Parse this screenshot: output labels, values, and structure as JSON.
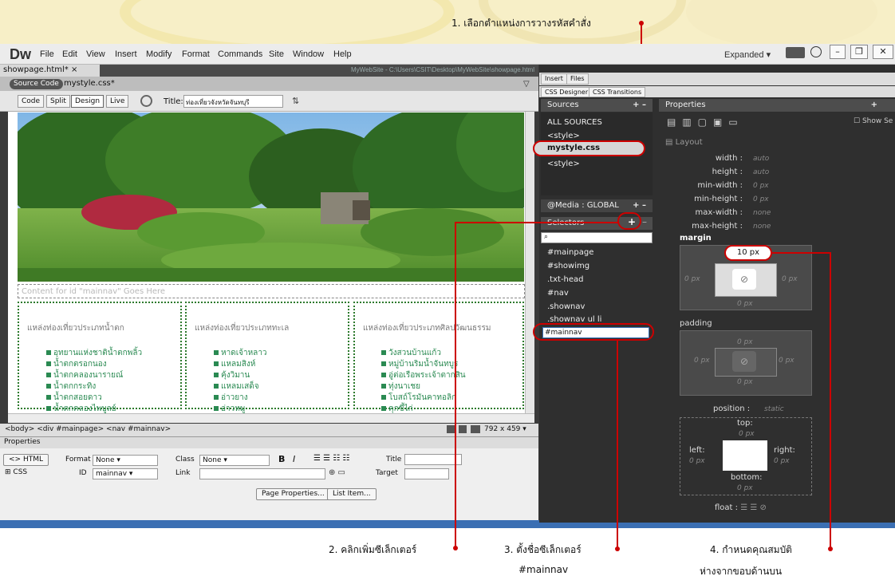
{
  "callouts": {
    "c1": "1. เลือกตำแหน่งการวางรหัสคำสั่ง",
    "c2": "2. คลิกเพิ่มซีเล็กเตอร์",
    "c3_line1": "3. ตั้งชื่อซีเล็กเตอร์",
    "c3_line2": "#mainnav",
    "c4_line1": "4. กำหนดคุณสมบัติ",
    "c4_line2": "ห่างจากขอบด้านบน"
  },
  "app": {
    "logo": "Dw",
    "menu": [
      "File",
      "Edit",
      "View",
      "Insert",
      "Modify",
      "Format",
      "Commands",
      "Site",
      "Window",
      "Help"
    ],
    "workspace": "Expanded",
    "doc_tab": "showpage.html* ×",
    "doc_path": "MyWebSite - C:\\Users\\CSIT\\Desktop\\MyWebSite\\showpage.html",
    "source_code": "Source Code",
    "related_file": "mystyle.css*",
    "views": [
      "Code",
      "Split",
      "Design",
      "Live"
    ],
    "title_label": "Title:",
    "title_value": "ท่องเที่ยวจังหวัดจันทบุรี"
  },
  "design": {
    "content_placeholder": "Content for id \"mainnav\" Goes Here",
    "columns": [
      {
        "head": "แหล่งท่องเที่ยวประเภทน้ำตก",
        "items": [
          "อุทยานแห่งชาติน้ำตกพลิ้ว",
          "น้ำตกตรอกนอง",
          "น้ำตกคลองนารายณ์",
          "น้ำตกกระทิง",
          "น้ำตกสอยดาว",
          "น้ำตกคลองไพบูลย์"
        ]
      },
      {
        "head": "แหล่งท่องเที่ยวประเภททะเล",
        "items": [
          "หาดเจ้าหลาว",
          "แหลมสิงห์",
          "คุ้งวิมาน",
          "แหลมเสด็จ",
          "อ่าวยาง",
          "อ่าวหมู"
        ]
      },
      {
        "head": "แหล่งท่องเที่ยวประเภทศิลปวัฒนธรรม",
        "items": [
          "วังสวนบ้านแก้ว",
          "หมู่บ้านริมน้ำจันทบูร",
          "อู่ต่อเรือพระเจ้าตากสิน",
          "ทุ่งนาเชย",
          "โบสถ์โรมันคาทอลิก",
          "คุกขี้ไก่"
        ]
      }
    ],
    "status_path": "<body> <div #mainpage> <nav #mainnav>",
    "window_size": "792 x 459 ▾"
  },
  "properties_panel": {
    "header": "Properties",
    "html_btn": "HTML",
    "css_btn": "CSS",
    "format_label": "Format",
    "format_value": "None",
    "class_label": "Class",
    "class_value": "None",
    "id_label": "ID",
    "id_value": "mainnav",
    "link_label": "Link",
    "title_label": "Title",
    "target_label": "Target",
    "page_properties": "Page Properties...",
    "list_item": "List Item..."
  },
  "right": {
    "insert_tabs": [
      "Insert",
      "Files"
    ],
    "css_tabs": [
      "CSS Designer",
      "CSS Transitions"
    ],
    "sources_title": "Sources",
    "sources": [
      "ALL SOURCES",
      "<style>",
      "mystyle.css",
      "<style>"
    ],
    "media_title": "@Media : GLOBAL",
    "selectors_title": "Selectors",
    "selectors": [
      "#mainpage",
      "#showimg",
      ".txt-head",
      "#nav",
      ".shownav",
      ".shownav ul li"
    ],
    "selector_input": "#mainnav",
    "properties_title": "Properties",
    "show_set": "Show Se",
    "layout_title": "Layout",
    "layout_props": [
      {
        "name": "width",
        "value": "auto"
      },
      {
        "name": "height",
        "value": "auto"
      },
      {
        "name": "min-width",
        "value": "0 px"
      },
      {
        "name": "min-height",
        "value": "0 px"
      },
      {
        "name": "max-width",
        "value": "none"
      },
      {
        "name": "max-height",
        "value": "none"
      }
    ],
    "margin_label": "margin",
    "margin_top": "10 px",
    "margin_side": "0 px",
    "padding_label": "padding",
    "padding_val": "0 px",
    "position_label": "position :",
    "position_value": "static",
    "top_label": "top:",
    "left_label": "left:",
    "right_label": "right:",
    "bottom_label": "bottom:",
    "float_label": "float :"
  },
  "colors": {
    "accent_red": "#cc0000",
    "panel_dark": "#2f2f2f",
    "link_green": "#2a8a52"
  }
}
